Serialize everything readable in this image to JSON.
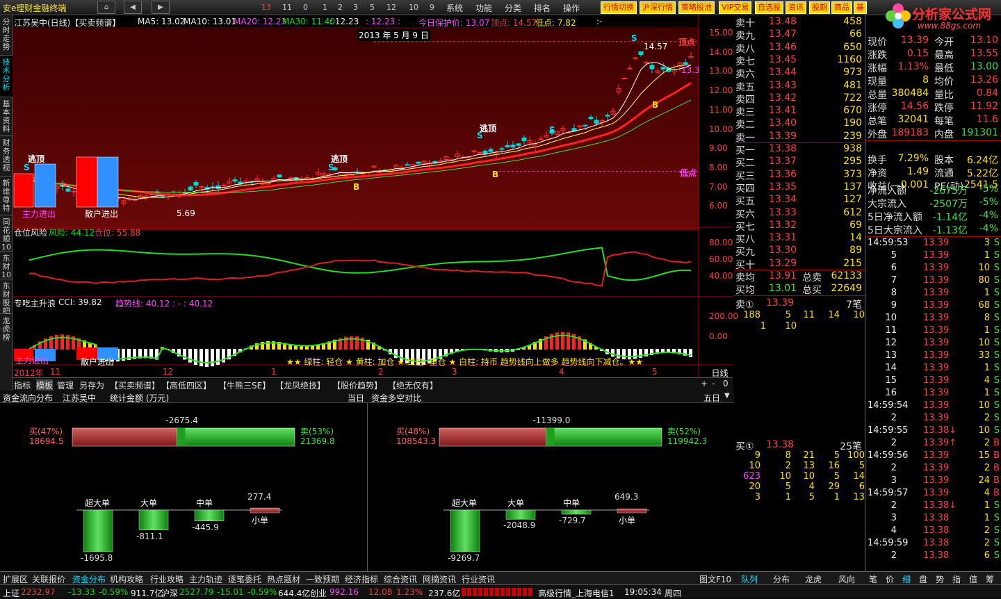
{
  "app": {
    "title": "安e理财金融终端",
    "nav_numbers": [
      "13",
      "11",
      "0",
      "1",
      "2",
      "3",
      "5",
      "12",
      "10",
      "9"
    ],
    "menus": [
      "系统",
      "功能",
      "分类",
      "排名",
      "操作"
    ],
    "func_buttons": [
      "行情切换",
      "沪深行情",
      "策略股池",
      "VIP交易",
      "自选股",
      "资讯",
      "股期",
      "商品",
      "基"
    ],
    "logo_text": "分析家公式网",
    "logo_url": "www.88gs.com"
  },
  "left_tabs": [
    "分时走势",
    "技术分析",
    "基本资料",
    "财务透视",
    "新维尊特",
    "同花顺10",
    "东财10",
    "东财股吧",
    "龙虎榜"
  ],
  "chart": {
    "title": "江苏吴中(日线)【买卖频谱】",
    "ma5": "MA5: 13.02",
    "ma10": "MA10: 13.01",
    "ma20": "MA20: 12.23",
    "ma30": "MA30: 11.40",
    "extra": ": 12.23",
    "extra2": ": 12.23 :",
    "date_label": "2013 年 5 月 9 日",
    "protect": "今日保护价: 13.07",
    "top": "顶点: 14.57",
    "low": "低点: 7.82",
    "dash": ":-",
    "y_labels": [
      "15.00",
      "14.00",
      "13.00",
      "12.00",
      "11.00",
      "10.00",
      "9.00",
      "8.00",
      "7.00",
      "6.00"
    ],
    "top_tag": "顶点",
    "low_tag": "低点",
    "price_last": "13.3",
    "hi_label": "14.57",
    "lo_label": "5.69",
    "escape_tags": [
      "逃顶",
      "逃顶",
      "逃顶"
    ],
    "b_tag": "B",
    "s_tag": "S",
    "main_in": "主力进出",
    "retail_in": "散户进出"
  },
  "pos": {
    "title": "仓位风险",
    "risk": "风险: 44.12",
    "cang": "仓位: 55.88",
    "y": [
      "80.00",
      "60.00",
      "40.00"
    ]
  },
  "cci": {
    "title": "专吃主升浪",
    "cci": "CCI: 39.82",
    "trend": "趋势线: 40.12 : - : 40.12",
    "y": [
      "200.00",
      "0.00"
    ],
    "legend": "★★ 绿柱: 轻仓 ★ 黄柱: 加仓 ★ 红柱: 重仓 ★ 白柱: 持币  趋势线向上做多  趋势线向下减仓。★★",
    "main_in": "主力进出",
    "retail_in": "散户进出"
  },
  "xaxis": {
    "labels": [
      "2012年",
      "11",
      "12",
      "1",
      "2",
      "3",
      "4",
      "5"
    ],
    "period": "日线"
  },
  "toolbar": {
    "items": [
      "指标",
      "模板",
      "管理",
      "另存为",
      "【买卖频谱】",
      "【高低四区】",
      "【牛熊三SE】",
      "【龙凤绝技】",
      "【股价趋势】",
      "【绝无仅有】"
    ],
    "plus": "+",
    "minus": "-",
    "zero": "0"
  },
  "fund": {
    "left_title": "资金流向分布",
    "stock": "江苏吴中",
    "unit": "统计金额 (万元)",
    "period_l": "当日",
    "right_title": "资金多空对比",
    "period_r": "五日",
    "l_net": "-2675.4",
    "l_buy_pct": "买(47%)",
    "l_buy": "18694.5",
    "l_sell_pct": "卖(53%)",
    "l_sell": "21369.8",
    "l_buy_ratio": 0.47,
    "r_net": "-11399.0",
    "r_buy_pct": "买(48%)",
    "r_buy": "108543.3",
    "r_sell_pct": "卖(52%)",
    "r_sell": "119942.3",
    "r_buy_ratio": 0.48,
    "l_bars": [
      {
        "name": "超大单",
        "v": "-1695.8",
        "val": -1695.8
      },
      {
        "name": "大单",
        "v": "-811.1",
        "val": -811.1
      },
      {
        "name": "中单",
        "v": "-445.9",
        "val": -445.9
      },
      {
        "name": "小单",
        "v": "277.4",
        "val": 277.4
      }
    ],
    "r_bars": [
      {
        "name": "超大单",
        "v": "-9269.7",
        "val": -9269.7
      },
      {
        "name": "大单",
        "v": "-2048.9",
        "val": -2048.9
      },
      {
        "name": "中单",
        "v": "-729.7",
        "val": -729.7
      },
      {
        "name": "小单",
        "v": "649.3",
        "val": 649.3
      }
    ]
  },
  "orderbook": {
    "sells": [
      [
        "卖十",
        "13.48",
        "458"
      ],
      [
        "卖九",
        "13.47",
        "66"
      ],
      [
        "卖八",
        "13.46",
        "650"
      ],
      [
        "卖七",
        "13.45",
        "1160"
      ],
      [
        "卖六",
        "13.44",
        "973"
      ],
      [
        "卖五",
        "13.43",
        "481"
      ],
      [
        "卖四",
        "13.42",
        "722"
      ],
      [
        "卖三",
        "13.41",
        "670"
      ],
      [
        "卖二",
        "13.40",
        "190"
      ],
      [
        "卖一",
        "13.39",
        "239"
      ]
    ],
    "buys": [
      [
        "买一",
        "13.38",
        "938"
      ],
      [
        "买二",
        "13.37",
        "295"
      ],
      [
        "买三",
        "13.36",
        "373"
      ],
      [
        "买四",
        "13.35",
        "137"
      ],
      [
        "买五",
        "13.34",
        "127"
      ],
      [
        "买六",
        "13.33",
        "612"
      ],
      [
        "买七",
        "13.32",
        "69"
      ],
      [
        "买八",
        "13.31",
        "14"
      ],
      [
        "买九",
        "13.30",
        "89"
      ],
      [
        "买十",
        "13.29",
        "215"
      ]
    ],
    "avg_sell": [
      "卖均",
      "13.91",
      "总卖",
      "62133"
    ],
    "avg_buy": [
      "买均",
      "13.01",
      "总买",
      "22649"
    ],
    "sell1_q": [
      "卖①",
      "13.39",
      "7笔"
    ],
    "sell1_lots": [
      "188",
      "5",
      "11",
      "14",
      "10",
      "1",
      "10"
    ],
    "buy1_q": [
      "买①",
      "13.38",
      "25笔"
    ],
    "buy1_lots": [
      [
        "9",
        "8",
        "21",
        "5",
        "100"
      ],
      [
        "10",
        "2",
        "13",
        "16",
        "5"
      ],
      [
        "623",
        "10",
        "10",
        "5",
        "14"
      ],
      [
        "20",
        "5",
        "4",
        "29",
        "6"
      ],
      [
        "3",
        "1",
        "5",
        "1",
        "13"
      ]
    ]
  },
  "quote": [
    [
      "现价",
      "13.39",
      "今开",
      "13.10"
    ],
    [
      "涨跌",
      "0.15",
      "最高",
      "13.55"
    ],
    [
      "涨幅",
      "1.13%",
      "最低",
      "13.00"
    ],
    [
      "现量",
      "8",
      "均价",
      "13.26"
    ],
    [
      "总量",
      "380484",
      "量比",
      "0.84"
    ],
    [
      "涨停",
      "14.56",
      "跌停",
      "11.92"
    ],
    [
      "总笔",
      "32041",
      "每笔",
      "11.6"
    ],
    [
      "外盘",
      "189183",
      "内盘",
      "191301"
    ],
    [
      "换手",
      "7.29%",
      "股本",
      "6.24亿"
    ],
    [
      "净资",
      "1.49",
      "流通",
      "5.22亿"
    ],
    [
      "收益(一)",
      "0.001",
      "PE(动)",
      "2541.5"
    ]
  ],
  "flows": [
    [
      "净流入额",
      "-2675万",
      "-5%"
    ],
    [
      "大宗流入",
      "-2507万",
      "-5%"
    ],
    [
      "5日净流入额",
      "-1.14亿",
      "-4%"
    ],
    [
      "5日大宗流入",
      "-1.13亿",
      "-4%"
    ]
  ],
  "ticks": [
    [
      "14:59:53",
      "13.39",
      "3",
      "S"
    ],
    [
      "5",
      "13.39",
      "1",
      "S"
    ],
    [
      "6",
      "13.39",
      "10",
      "S"
    ],
    [
      "7",
      "13.39",
      "80",
      "S"
    ],
    [
      "8",
      "13.39",
      "1",
      "S"
    ],
    [
      "9",
      "13.39",
      "68",
      "S"
    ],
    [
      "10",
      "13.39",
      "8",
      "S"
    ],
    [
      "11",
      "13.39",
      "1",
      "S"
    ],
    [
      "12",
      "13.39",
      "10",
      "S"
    ],
    [
      "13",
      "13.39",
      "33",
      "S"
    ],
    [
      "14",
      "13.39",
      "1",
      "S"
    ],
    [
      "15",
      "13.39",
      "4",
      "S"
    ],
    [
      "16",
      "13.39",
      "1",
      "S"
    ],
    [
      "14:59:54",
      "13.39",
      "10",
      "S"
    ],
    [
      "2",
      "13.39",
      "2",
      "S"
    ],
    [
      "14:59:55",
      "13.38↓",
      "10",
      "S"
    ],
    [
      "2",
      "13.39↑",
      "2",
      "B"
    ],
    [
      "14:59:56",
      "13.39",
      "15",
      "B"
    ],
    [
      "2",
      "13.39",
      "2",
      "B"
    ],
    [
      "3",
      "13.39",
      "24",
      "B"
    ],
    [
      "14:59:57",
      "13.39",
      "4",
      "B"
    ],
    [
      "2",
      "13.38↓",
      "1",
      "S"
    ],
    [
      "3",
      "13.38",
      "1",
      "S"
    ],
    [
      "4",
      "13.38",
      "2",
      "S"
    ],
    [
      "14:59:59",
      "13.38",
      "2",
      "S"
    ],
    [
      "2",
      "13.38",
      "6",
      "S"
    ]
  ],
  "bottom_tabs": [
    "扩展区",
    "关联报价",
    "资金分布",
    "机构攻略",
    "行业攻略",
    "主力轨迹",
    "逐笔委托",
    "热点题材",
    "一致预期",
    "经济指标",
    "综合资讯",
    "网摘资讯",
    "行业资讯"
  ],
  "bottom_right": [
    "图文F10",
    "队列",
    "分布",
    "龙虎",
    "风向",
    "笔",
    "价",
    "细",
    "盘",
    "势",
    "指",
    "值",
    "筹"
  ],
  "status": {
    "sh": "上证",
    "sh_v": "2232.97",
    "sh_c": "-13.33",
    "sh_p": "-0.59%",
    "sh_a": "911.7亿",
    "hs": "沪深",
    "hs_v": "2527.79",
    "hs_c": "-15.01",
    "hs_p": "-0.59%",
    "hs_a": "644.4亿",
    "cy": "创业",
    "cy_v": "992.16",
    "cy_c": "12.08",
    "cy_p": "1.23%",
    "cy_a": "237.6亿",
    "feed": "高级行情_上海电信1",
    "time": "19:05:34",
    "day": "周四"
  }
}
